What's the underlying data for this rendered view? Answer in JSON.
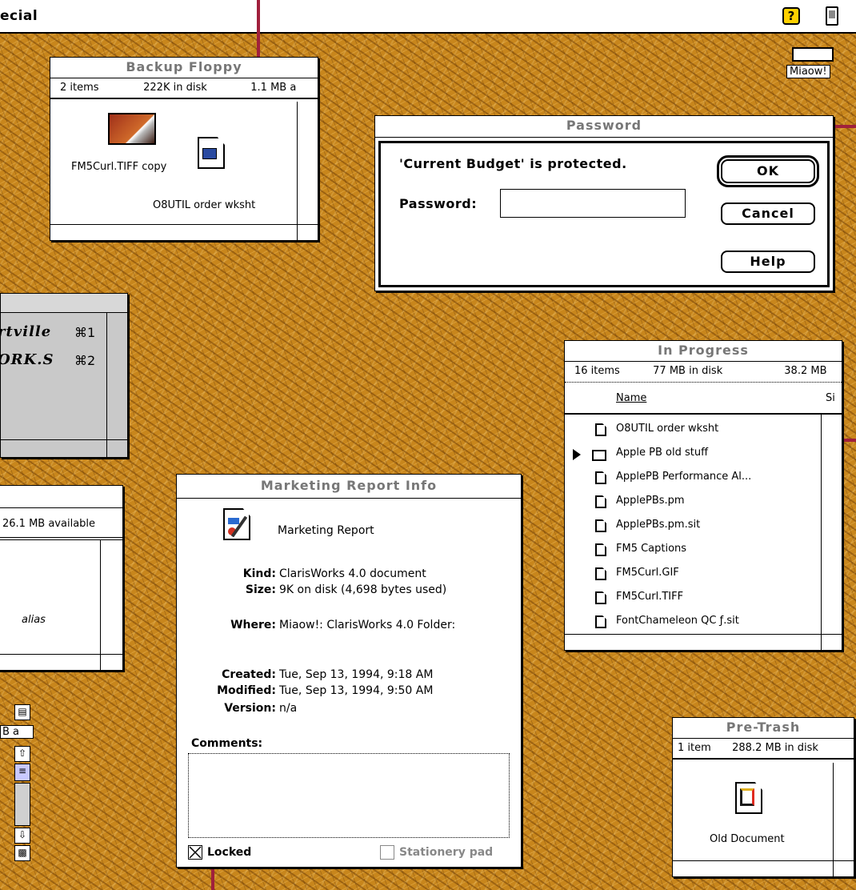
{
  "menubar": {
    "title": "ecial",
    "help_icon": "help-icon",
    "help_glyph": "?",
    "app_icon": "application-icon"
  },
  "backup_floppy": {
    "title": "Backup Floppy",
    "items": "2 items",
    "in_disk": "222K in disk",
    "available": "1.1 MB a",
    "files": [
      {
        "label": "FM5Curl.TIFF copy",
        "icon": "tiff-image-icon"
      },
      {
        "label": "O8UTIL order wksht",
        "icon": "spreadsheet-document-icon"
      }
    ]
  },
  "miaow": {
    "label": "Miaow!",
    "icon": "hard-disk-icon"
  },
  "password_dialog": {
    "title": "Password",
    "message": "'Current Budget' is protected.",
    "field_label": "Password:",
    "field_value": "",
    "ok": "OK",
    "cancel": "Cancel",
    "help": "Help"
  },
  "font_window": {
    "rows": [
      {
        "name": "rtville",
        "shortcut": "⌘1"
      },
      {
        "name": "ORK.S",
        "shortcut": "⌘2"
      }
    ]
  },
  "in_progress": {
    "title": "In Progress",
    "items": "16 items",
    "in_disk": "77 MB in disk",
    "available": "38.2 MB",
    "col_name": "Name",
    "col_size": "Si",
    "rows": [
      {
        "name": "O8UTIL order wksht",
        "kind": "document"
      },
      {
        "name": "Apple PB old stuff",
        "kind": "folder"
      },
      {
        "name": "ApplePB Performance Al...",
        "kind": "document"
      },
      {
        "name": "ApplePBs.pm",
        "kind": "document"
      },
      {
        "name": "ApplePBs.pm.sit",
        "kind": "document"
      },
      {
        "name": "FM5 Captions",
        "kind": "document"
      },
      {
        "name": "FM5Curl.GIF",
        "kind": "document"
      },
      {
        "name": "FM5Curl.TIFF",
        "kind": "document"
      },
      {
        "name": "FontChameleon QC ƒ.sit",
        "kind": "document"
      }
    ]
  },
  "left_window": {
    "available": "26.1 MB available",
    "alias_label": "alias"
  },
  "scroll_strip": {
    "partial_text": "B a"
  },
  "info_window": {
    "title": "Marketing Report Info",
    "doc_name": "Marketing Report",
    "doc_icon": "document-icon",
    "kind_label": "Kind:",
    "kind_value": "ClarisWorks 4.0 document",
    "size_label": "Size:",
    "size_value": "9K on disk (4,698 bytes used)",
    "where_label": "Where:",
    "where_value": "Miaow!: ClarisWorks 4.0 Folder:",
    "created_label": "Created:",
    "created_value": "Tue, Sep 13, 1994, 9:18 AM",
    "modified_label": "Modified:",
    "modified_value": "Tue, Sep 13, 1994, 9:50 AM",
    "version_label": "Version:",
    "version_value": "n/a",
    "comments_label": "Comments:",
    "comments_value": "",
    "locked_label": "Locked",
    "locked_checked": true,
    "stationery_label": "Stationery pad",
    "stationery_checked": false
  },
  "pre_trash": {
    "title": "Pre-Trash",
    "items": "1 item",
    "in_disk": "288.2 MB in disk",
    "file": {
      "label": "Old Document",
      "icon": "document-icon"
    }
  },
  "colors": {
    "desktop": "#c8861c",
    "callout": "#a0203c",
    "title_text": "#777777"
  }
}
